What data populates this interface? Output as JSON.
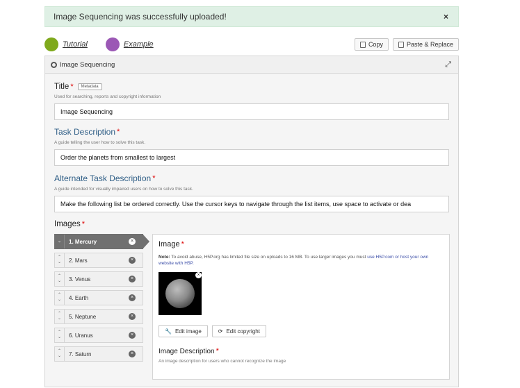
{
  "alert": {
    "message": "Image Sequencing was successfully uploaded!",
    "close": "×"
  },
  "toolbar": {
    "tutorial": "Tutorial",
    "example": "Example",
    "tutorial_color": "#7fa91c",
    "example_color": "#9b58b5",
    "copy": "Copy",
    "paste": "Paste & Replace"
  },
  "panel": {
    "title": "Image Sequencing",
    "expand": "⤢"
  },
  "title_field": {
    "label": "Title",
    "required": "*",
    "tag": "Metadata",
    "description": "Used for searching, reports and copyright information",
    "value": "Image Sequencing"
  },
  "task": {
    "label": "Task Description",
    "required": "*",
    "description": "A guide telling the user how to solve this task.",
    "value": "Order the planets from smallest to largest"
  },
  "alt_task": {
    "label": "Alternate Task Description",
    "required": "*",
    "description": "A guide intended for visually impaired users on how to solve this task.",
    "value": "Make the following list be ordered correctly. Use the cursor keys to navigate through the list items, use space to activate or dea"
  },
  "images": {
    "label": "Images",
    "required": "*",
    "items": [
      {
        "label": "1. Mercury"
      },
      {
        "label": "2. Mars"
      },
      {
        "label": "3. Venus"
      },
      {
        "label": "4. Earth"
      },
      {
        "label": "5. Neptune"
      },
      {
        "label": "6. Uranus"
      },
      {
        "label": "7. Saturn"
      }
    ]
  },
  "image_detail": {
    "label": "Image",
    "required": "*",
    "note_bold": "Note:",
    "note": " To avoid abuse, H5P.org has limited file size on uploads to 16 MB. To use larger images you must ",
    "note_link": "use H5P.com or host your own website with H5P.",
    "edit_image": "Edit image",
    "edit_copyright": "Edit copyright",
    "desc_label": "Image Description",
    "desc_required": "*",
    "desc_text": "An image description for users who cannot recognize the image"
  }
}
